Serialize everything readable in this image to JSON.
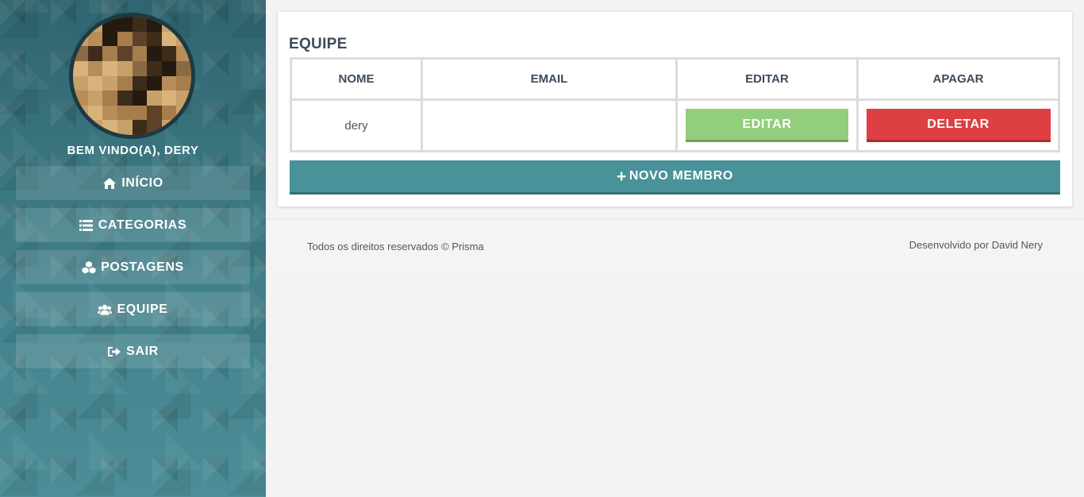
{
  "sidebar": {
    "welcome": "BEM VINDO(A), DERY",
    "items": [
      {
        "label": "INÍCIO",
        "icon": "home-icon"
      },
      {
        "label": "CATEGORIAS",
        "icon": "list-icon"
      },
      {
        "label": "POSTAGENS",
        "icon": "cubes-icon"
      },
      {
        "label": "EQUIPE",
        "icon": "users-icon"
      },
      {
        "label": "SAIR",
        "icon": "sign-out-icon"
      }
    ]
  },
  "main": {
    "title": "EQUIPE",
    "table": {
      "headers": [
        "NOME",
        "EMAIL",
        "EDITAR",
        "APAGAR"
      ],
      "rows": [
        {
          "nome": "dery",
          "email": "",
          "edit_label": "EDITAR",
          "delete_label": "DELETAR"
        }
      ]
    },
    "new_member_label": "NOVO MEMBRO"
  },
  "footer": {
    "left": "Todos os direitos reservados © Prisma",
    "right": "Desenvolvido por David Nery"
  },
  "colors": {
    "sidebar": "#3f7f88",
    "edit_button": "#92ce7b",
    "delete_button": "#dd3f43",
    "new_button": "#4a9299",
    "title_text": "#3d4b5b"
  }
}
